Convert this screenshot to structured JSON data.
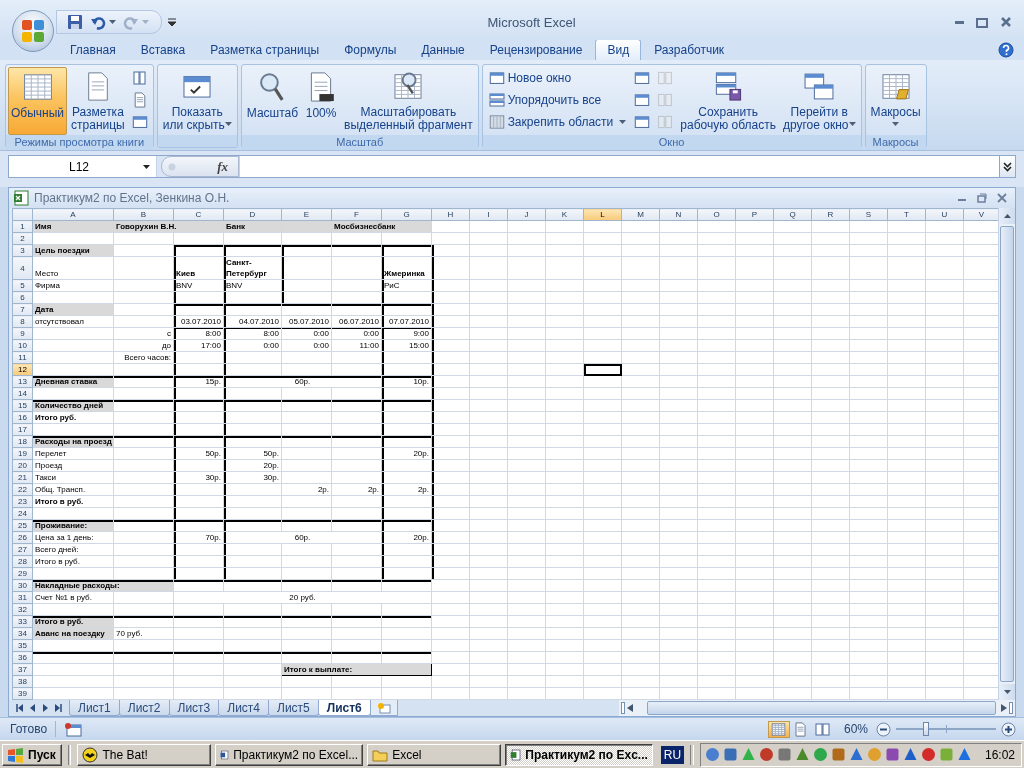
{
  "app": {
    "title": "Microsoft Excel"
  },
  "ribbon_tabs": [
    {
      "label": "Главная",
      "selected": false
    },
    {
      "label": "Вставка",
      "selected": false
    },
    {
      "label": "Разметка страницы",
      "selected": false
    },
    {
      "label": "Формулы",
      "selected": false
    },
    {
      "label": "Данные",
      "selected": false
    },
    {
      "label": "Рецензирование",
      "selected": false
    },
    {
      "label": "Вид",
      "selected": true
    },
    {
      "label": "Разработчик",
      "selected": false
    }
  ],
  "ribbon_groups": [
    {
      "label": "Режимы просмотра книги",
      "items": [
        {
          "kind": "large",
          "lines": [
            "Обычный"
          ],
          "selected": true,
          "dropdown": false,
          "disabled": false
        },
        {
          "kind": "large",
          "lines": [
            "Разметка",
            "страницы"
          ],
          "selected": false,
          "dropdown": false,
          "disabled": false
        },
        {
          "kind": "stack",
          "buttons": [
            {
              "kind": "icon",
              "disabled": false
            },
            {
              "kind": "icon",
              "disabled": false
            },
            {
              "kind": "icon",
              "disabled": false
            }
          ]
        }
      ]
    },
    {
      "items": [
        {
          "kind": "large",
          "lines": [
            "Показать",
            "или скрыть"
          ],
          "selected": false,
          "dropdown": true,
          "disabled": false
        }
      ]
    },
    {
      "label": "Масштаб",
      "items": [
        {
          "kind": "large",
          "lines": [
            "Масштаб"
          ],
          "selected": false,
          "dropdown": false,
          "disabled": false
        },
        {
          "kind": "large",
          "lines": [
            "100%"
          ],
          "selected": false,
          "dropdown": false,
          "disabled": false
        },
        {
          "kind": "large",
          "lines": [
            "Масштабировать",
            "выделенный фрагмент"
          ],
          "selected": false,
          "dropdown": false,
          "disabled": false
        }
      ]
    },
    {
      "label": "Окно",
      "items": [
        {
          "kind": "stack",
          "buttons": [
            {
              "kind": "small",
              "label": "Новое окно",
              "dropdown": false,
              "disabled": false
            },
            {
              "kind": "small",
              "label": "Упорядочить все",
              "dropdown": false,
              "disabled": false
            },
            {
              "kind": "small",
              "label": "Закрепить области",
              "dropdown": true,
              "disabled": false
            }
          ]
        },
        {
          "kind": "stack",
          "buttons": [
            {
              "kind": "icon",
              "disabled": false
            },
            {
              "kind": "icon",
              "disabled": false
            },
            {
              "kind": "icon",
              "disabled": false
            }
          ]
        },
        {
          "kind": "stack",
          "buttons": [
            {
              "kind": "icon",
              "disabled": true
            },
            {
              "kind": "icon",
              "disabled": true
            },
            {
              "kind": "icon",
              "disabled": true
            }
          ]
        },
        {
          "kind": "large",
          "lines": [
            "Сохранить",
            "рабочую область"
          ],
          "selected": false,
          "dropdown": false,
          "disabled": false
        },
        {
          "kind": "large",
          "lines": [
            "Перейти в",
            "другое окно"
          ],
          "selected": false,
          "dropdown": true,
          "disabled": false
        }
      ]
    },
    {
      "label": "Макросы",
      "items": [
        {
          "kind": "large",
          "lines": [
            "Макросы"
          ],
          "selected": false,
          "dropdown": true,
          "disabled": false
        }
      ]
    }
  ],
  "formula_bar": {
    "name_box": "L12",
    "function_button": "fx"
  },
  "workbook": {
    "title": "Практикум2 по Excel, Зенкина О.Н.",
    "columns": [
      {
        "label": "A",
        "selected": false
      },
      {
        "label": "B",
        "selected": false
      },
      {
        "label": "C",
        "selected": false
      },
      {
        "label": "D",
        "selected": false
      },
      {
        "label": "E",
        "selected": false
      },
      {
        "label": "F",
        "selected": false
      },
      {
        "label": "G",
        "selected": false
      },
      {
        "label": "H",
        "selected": false
      },
      {
        "label": "I",
        "selected": false
      },
      {
        "label": "J",
        "selected": false
      },
      {
        "label": "K",
        "selected": false
      },
      {
        "label": "L",
        "selected": true
      },
      {
        "label": "M",
        "selected": false
      },
      {
        "label": "N",
        "selected": false
      },
      {
        "label": "O",
        "selected": false
      },
      {
        "label": "P",
        "selected": false
      },
      {
        "label": "Q",
        "selected": false
      },
      {
        "label": "R",
        "selected": false
      },
      {
        "label": "S",
        "selected": false
      },
      {
        "label": "T",
        "selected": false
      },
      {
        "label": "U",
        "selected": false
      },
      {
        "label": "V",
        "selected": false
      }
    ],
    "rows": [
      {
        "label": "1",
        "selected": false,
        "kind": "plain",
        "cells": [
          {
            "kind": "left",
            "text": "Имя",
            "bold": true,
            "fill": true
          },
          {
            "kind": "left",
            "text": "Говорухин В.Н.",
            "bold": true,
            "fill": true,
            "colspan": 2
          },
          {
            "kind": "left",
            "text": "Банк",
            "bold": true,
            "fill": true
          },
          {
            "kind": "shade"
          },
          {
            "kind": "left",
            "text": "Мосбизнесбанк",
            "bold": true,
            "fill": true,
            "colspan": 2
          }
        ]
      },
      {
        "label": "2",
        "selected": false,
        "kind": "plain",
        "cells": []
      },
      {
        "label": "3",
        "selected": false,
        "kind": "placestop",
        "cells": [
          {
            "kind": "left",
            "text": "Цель поездки",
            "bold": true,
            "fill": true
          }
        ]
      },
      {
        "label": "4",
        "selected": false,
        "kind": "places",
        "cells": [
          {
            "kind": "left",
            "text": "Место",
            "bold": false,
            "fill": false
          },
          {
            "kind": "blank"
          },
          {
            "kind": "left",
            "text": "Киев",
            "bold": true,
            "fill": false
          },
          {
            "kind": "wrap",
            "text": "Санкт-Петербург",
            "bold": true,
            "fill": false
          },
          {
            "kind": "blank"
          },
          {
            "kind": "blank"
          },
          {
            "kind": "left",
            "text": "Жмеринка",
            "bold": true,
            "fill": false
          }
        ]
      },
      {
        "label": "5",
        "selected": false,
        "kind": "places",
        "cells": [
          {
            "kind": "left",
            "text": "Фирма",
            "bold": false,
            "fill": false
          },
          {
            "kind": "blank"
          },
          {
            "kind": "left",
            "text": "BNV",
            "bold": false,
            "fill": false
          },
          {
            "kind": "left",
            "text": "BNV",
            "bold": false,
            "fill": false
          },
          {
            "kind": "blank"
          },
          {
            "kind": "blank"
          },
          {
            "kind": "left",
            "text": "РиС",
            "bold": false,
            "fill": false
          }
        ]
      },
      {
        "label": "6",
        "selected": false,
        "kind": "places",
        "cells": []
      },
      {
        "label": "7",
        "selected": false,
        "kind": "daystop",
        "cells": [
          {
            "kind": "left",
            "text": "Дата",
            "bold": true,
            "fill": true
          }
        ]
      },
      {
        "label": "8",
        "selected": false,
        "kind": "days",
        "cells": [
          {
            "kind": "left",
            "text": "отсутствовал",
            "bold": false,
            "fill": false
          },
          {
            "kind": "blank"
          },
          {
            "kind": "right",
            "text": "03.07.2010",
            "bold": false,
            "fill": false
          },
          {
            "kind": "right",
            "text": "04.07.2010",
            "bold": false,
            "fill": false
          },
          {
            "kind": "right",
            "text": "05.07.2010",
            "bold": false,
            "fill": false
          },
          {
            "kind": "right",
            "text": "06.07.2010",
            "bold": false,
            "fill": false
          },
          {
            "kind": "right",
            "text": "07.07.2010",
            "bold": false,
            "fill": false
          }
        ]
      },
      {
        "label": "9",
        "selected": false,
        "kind": "daysthin",
        "cells": [
          {
            "kind": "blank"
          },
          {
            "kind": "right",
            "text": "с",
            "bold": false,
            "fill": false
          },
          {
            "kind": "right",
            "text": "8:00",
            "bold": false,
            "fill": false
          },
          {
            "kind": "right",
            "text": "8:00",
            "bold": false,
            "fill": false
          },
          {
            "kind": "right",
            "text": "0:00",
            "bold": false,
            "fill": false
          },
          {
            "kind": "right",
            "text": "0:00",
            "bold": false,
            "fill": false
          },
          {
            "kind": "right",
            "text": "9:00",
            "bold": false,
            "fill": false
          }
        ]
      },
      {
        "label": "10",
        "selected": false,
        "kind": "days",
        "cells": [
          {
            "kind": "blank"
          },
          {
            "kind": "right",
            "text": "до",
            "bold": false,
            "fill": false
          },
          {
            "kind": "right",
            "text": "17:00",
            "bold": false,
            "fill": false
          },
          {
            "kind": "right",
            "text": "0:00",
            "bold": false,
            "fill": false
          },
          {
            "kind": "right",
            "text": "0:00",
            "bold": false,
            "fill": false
          },
          {
            "kind": "right",
            "text": "11:00",
            "bold": false,
            "fill": false
          },
          {
            "kind": "right",
            "text": "15:00",
            "bold": false,
            "fill": false
          }
        ]
      },
      {
        "label": "11",
        "selected": false,
        "kind": "days",
        "cells": [
          {
            "kind": "blank"
          },
          {
            "kind": "right",
            "text": "Всего часов:",
            "bold": false,
            "fill": false
          }
        ]
      },
      {
        "label": "12",
        "selected": true,
        "kind": "days",
        "cells": []
      },
      {
        "label": "13",
        "selected": false,
        "kind": "daysfull",
        "cells": [
          {
            "kind": "left",
            "text": "Дневная ставка",
            "bold": true,
            "fill": true
          },
          {
            "kind": "blank"
          },
          {
            "kind": "right",
            "text": "15р.",
            "bold": false,
            "fill": false
          },
          {
            "kind": "center",
            "text": "60р.",
            "bold": false,
            "fill": false,
            "colspan": 3
          },
          {
            "kind": "right",
            "text": "10р.",
            "bold": false,
            "fill": false
          }
        ]
      },
      {
        "label": "14",
        "selected": false,
        "kind": "days",
        "cells": []
      },
      {
        "label": "15",
        "selected": false,
        "kind": "daysfull",
        "cells": [
          {
            "kind": "left",
            "text": "Количество дней",
            "bold": true,
            "fill": true
          }
        ]
      },
      {
        "label": "16",
        "selected": false,
        "kind": "days",
        "cells": [
          {
            "kind": "left",
            "text": "Итого руб.",
            "bold": true,
            "fill": false
          }
        ]
      },
      {
        "label": "17",
        "selected": false,
        "kind": "days",
        "cells": []
      },
      {
        "label": "18",
        "selected": false,
        "kind": "daysfull",
        "cells": [
          {
            "kind": "left",
            "text": "Расходы на проезд",
            "bold": true,
            "fill": true
          }
        ]
      },
      {
        "label": "19",
        "selected": false,
        "kind": "days",
        "cells": [
          {
            "kind": "left",
            "text": "Перелет",
            "bold": false,
            "fill": false
          },
          {
            "kind": "blank"
          },
          {
            "kind": "right",
            "text": "50р.",
            "bold": false,
            "fill": false
          },
          {
            "kind": "right",
            "text": "50р.",
            "bold": false,
            "fill": false
          },
          {
            "kind": "blank"
          },
          {
            "kind": "blank"
          },
          {
            "kind": "right",
            "text": "20р.",
            "bold": false,
            "fill": false
          }
        ]
      },
      {
        "label": "20",
        "selected": false,
        "kind": "days",
        "cells": [
          {
            "kind": "left",
            "text": "Проезд",
            "bold": false,
            "fill": false
          },
          {
            "kind": "blank"
          },
          {
            "kind": "blank"
          },
          {
            "kind": "right",
            "text": "20р.",
            "bold": false,
            "fill": false
          }
        ]
      },
      {
        "label": "21",
        "selected": false,
        "kind": "days",
        "cells": [
          {
            "kind": "left",
            "text": "Такси",
            "bold": false,
            "fill": false
          },
          {
            "kind": "blank"
          },
          {
            "kind": "right",
            "text": "30р.",
            "bold": false,
            "fill": false
          },
          {
            "kind": "right",
            "text": "30р.",
            "bold": false,
            "fill": false
          }
        ]
      },
      {
        "label": "22",
        "selected": false,
        "kind": "days",
        "cells": [
          {
            "kind": "left",
            "text": "Общ. Трансп.",
            "bold": false,
            "fill": false
          },
          {
            "kind": "blank"
          },
          {
            "kind": "blank"
          },
          {
            "kind": "blank"
          },
          {
            "kind": "right",
            "text": "2р.",
            "bold": false,
            "fill": false
          },
          {
            "kind": "right",
            "text": "2р.",
            "bold": false,
            "fill": false
          },
          {
            "kind": "right",
            "text": "2р.",
            "bold": false,
            "fill": false
          }
        ]
      },
      {
        "label": "23",
        "selected": false,
        "kind": "days",
        "cells": [
          {
            "kind": "left",
            "text": "Итого в руб.",
            "bold": true,
            "fill": false
          }
        ]
      },
      {
        "label": "24",
        "selected": false,
        "kind": "days",
        "cells": []
      },
      {
        "label": "25",
        "selected": false,
        "kind": "daysfull",
        "cells": [
          {
            "kind": "left",
            "text": "Проживание:",
            "bold": true,
            "fill": true
          }
        ]
      },
      {
        "label": "26",
        "selected": false,
        "kind": "days",
        "cells": [
          {
            "kind": "left",
            "text": "Цена за 1 день:",
            "bold": false,
            "fill": false
          },
          {
            "kind": "blank"
          },
          {
            "kind": "right",
            "text": "70р.",
            "bold": false,
            "fill": false
          },
          {
            "kind": "center",
            "text": "60р.",
            "bold": false,
            "fill": false,
            "colspan": 3
          },
          {
            "kind": "right",
            "text": "20р.",
            "bold": false,
            "fill": false
          }
        ]
      },
      {
        "label": "27",
        "selected": false,
        "kind": "days",
        "cells": [
          {
            "kind": "left",
            "text": "Всего дней:",
            "bold": false,
            "fill": false
          }
        ]
      },
      {
        "label": "28",
        "selected": false,
        "kind": "days",
        "cells": [
          {
            "kind": "left",
            "text": "Итого в руб.",
            "bold": false,
            "fill": false
          }
        ]
      },
      {
        "label": "29",
        "selected": false,
        "kind": "days",
        "cells": []
      },
      {
        "label": "30",
        "selected": false,
        "kind": "rulefull",
        "cells": [
          {
            "kind": "left",
            "text": "Накладные расходы:",
            "bold": true,
            "fill": true,
            "colspan": 2
          }
        ]
      },
      {
        "label": "31",
        "selected": false,
        "kind": "plain",
        "cells": [
          {
            "kind": "left",
            "text": "Счет №1 в руб.",
            "bold": false,
            "fill": false
          },
          {
            "kind": "blank"
          },
          {
            "kind": "center",
            "text": "20 руб.",
            "bold": false,
            "fill": false,
            "colspan": 5
          }
        ]
      },
      {
        "label": "32",
        "selected": false,
        "kind": "plain",
        "cells": []
      },
      {
        "label": "33",
        "selected": false,
        "kind": "rulefull",
        "cells": [
          {
            "kind": "left",
            "text": "Итого в руб.",
            "bold": true,
            "fill": true
          }
        ]
      },
      {
        "label": "34",
        "selected": false,
        "kind": "plain",
        "cells": [
          {
            "kind": "left",
            "text": "Аванс на поездку",
            "bold": true,
            "fill": true
          },
          {
            "kind": "left",
            "text": "70 руб.",
            "bold": false,
            "fill": false
          }
        ]
      },
      {
        "label": "35",
        "selected": false,
        "kind": "plain",
        "cells": []
      },
      {
        "label": "36",
        "selected": false,
        "kind": "rulefull",
        "cells": []
      },
      {
        "label": "37",
        "selected": false,
        "kind": "plain",
        "cells": [
          {
            "kind": "blank"
          },
          {
            "kind": "blank"
          },
          {
            "kind": "blank"
          },
          {
            "kind": "blank"
          },
          {
            "kind": "left",
            "text": "Итого к выплате:",
            "bold": true,
            "fill": true,
            "colspan": 3,
            "boxed": true
          }
        ]
      },
      {
        "label": "38",
        "selected": false,
        "kind": "plain",
        "cells": []
      },
      {
        "label": "39",
        "selected": false,
        "kind": "plain",
        "cells": []
      }
    ],
    "sheet_tabs": [
      {
        "label": "Лист1",
        "selected": false
      },
      {
        "label": "Лист2",
        "selected": false
      },
      {
        "label": "Лист3",
        "selected": false
      },
      {
        "label": "Лист4",
        "selected": false
      },
      {
        "label": "Лист5",
        "selected": false
      },
      {
        "label": "Лист6",
        "selected": true
      }
    ]
  },
  "status_bar": {
    "text": "Готово",
    "views": [
      {
        "selected": true
      },
      {
        "selected": false
      },
      {
        "selected": false
      }
    ],
    "zoom": "60%",
    "zoom_slider": {
      "level": 0.3
    }
  },
  "taskbar": {
    "start": "Пуск",
    "tasks": [
      {
        "label": "The Bat!",
        "selected": false
      },
      {
        "label": "Практикум2 по Excel...",
        "selected": false
      },
      {
        "label": "Excel",
        "selected": false
      },
      {
        "label": "Практикум2 по Exc...",
        "selected": true
      }
    ],
    "language": "RU",
    "clock": "16:02"
  }
}
